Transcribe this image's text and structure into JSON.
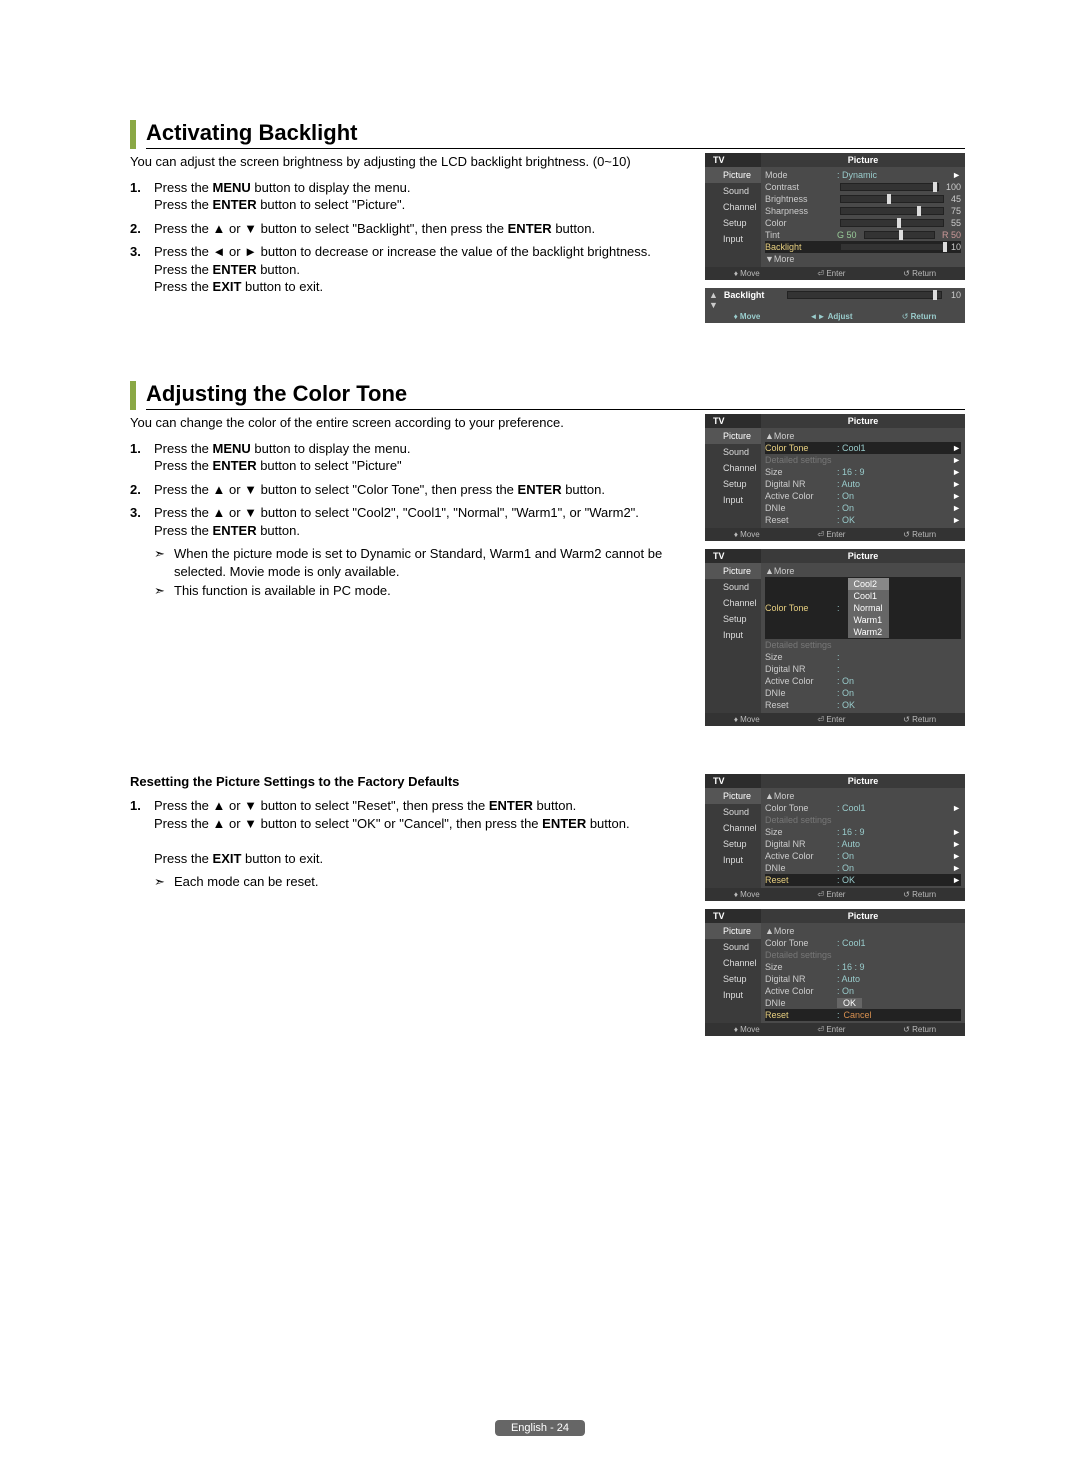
{
  "section1": {
    "title": "Activating Backlight",
    "intro": "You can adjust the screen brightness by adjusting the LCD backlight brightness. (0~10)",
    "steps": [
      {
        "num": "1.",
        "html": "Press the <b>MENU</b> button to display the menu.<br>Press the <b>ENTER</b> button to select \"Picture\"."
      },
      {
        "num": "2.",
        "html": "Press the ▲ or ▼ button to select \"Backlight\", then press the <b>ENTER</b> button."
      },
      {
        "num": "3.",
        "html": "Press the ◄ or ► button to decrease or increase the value of the backlight brightness.<br>Press the <b>ENTER</b> button.<br>Press the <b>EXIT</b> button to exit."
      }
    ]
  },
  "section2": {
    "title": "Adjusting the Color Tone",
    "intro": "You can change the color of the entire screen according to your preference.",
    "steps": [
      {
        "num": "1.",
        "html": "Press the <b>MENU</b> button to display the menu.<br>Press the <b>ENTER</b> button to select \"Picture\""
      },
      {
        "num": "2.",
        "html": "Press the ▲ or ▼ button to select \"Color Tone\", then press the <b>ENTER</b> button."
      },
      {
        "num": "3.",
        "html": "Press the ▲ or ▼ button to select \"Cool2\", \"Cool1\", \"Normal\", \"Warm1\", or \"Warm2\".<br>Press the <b>ENTER</b> button."
      }
    ],
    "notes": [
      "When the picture mode is set to Dynamic or Standard, Warm1 and Warm2 cannot be selected. Movie mode is only available.",
      "This function is available in PC mode."
    ]
  },
  "section3": {
    "subhead": "Resetting the Picture Settings to the Factory Defaults",
    "steps": [
      {
        "num": "1.",
        "html": "Press the ▲ or ▼ button to select \"Reset\", then press the <b>ENTER</b> button.<br>Press the ▲ or ▼ button to select \"OK\" or \"Cancel\", then press the <b>ENTER</b> button.<br><br>Press the <b>EXIT</b> button to exit."
      }
    ],
    "notes": [
      "Each mode can be reset."
    ]
  },
  "osd": {
    "tv": "TV",
    "picture": "Picture",
    "side": [
      "Picture",
      "Sound",
      "Channel",
      "Setup",
      "Input"
    ],
    "foot": {
      "move": "Move",
      "enter": "Enter",
      "return": "Return",
      "adjust": "Adjust"
    }
  },
  "osd1": {
    "rows": [
      {
        "label": "Mode",
        "val": ": Dynamic",
        "arrow": "►"
      },
      {
        "label": "Contrast",
        "slider": 95,
        "num": "100"
      },
      {
        "label": "Brightness",
        "slider": 45,
        "num": "45"
      },
      {
        "label": "Sharpness",
        "slider": 75,
        "num": "75"
      },
      {
        "label": "Color",
        "slider": 55,
        "num": "55"
      },
      {
        "label": "Tint",
        "tint": true,
        "g": "G 50",
        "r": "R 50"
      },
      {
        "label": "Backlight",
        "slider": 100,
        "num": "10",
        "sel": true
      },
      {
        "label": "▼More"
      }
    ]
  },
  "osd_mini": {
    "label": "Backlight",
    "num": "10"
  },
  "osd2": {
    "rows": [
      {
        "label": "▲More"
      },
      {
        "label": "Color Tone",
        "val": ": Cool1",
        "arrow": "►",
        "sel": true
      },
      {
        "label": "Detailed settings",
        "disabled": true,
        "arrow": "►"
      },
      {
        "label": "Size",
        "val": ": 16 : 9",
        "arrow": "►"
      },
      {
        "label": "Digital NR",
        "val": ": Auto",
        "arrow": "►"
      },
      {
        "label": "Active Color",
        "val": ": On",
        "arrow": "►"
      },
      {
        "label": "DNIe",
        "val": ": On",
        "arrow": "►"
      },
      {
        "label": "Reset",
        "val": ": OK",
        "arrow": "►"
      }
    ]
  },
  "osd3": {
    "rows": [
      {
        "label": "▲More"
      },
      {
        "label": "Color Tone",
        "val": ":",
        "sel": true,
        "dropdown": [
          "Cool2",
          "Cool1",
          "Normal",
          "Warm1",
          "Warm2"
        ],
        "hi": 0
      },
      {
        "label": "Detailed settings",
        "disabled": true
      },
      {
        "label": "Size",
        "val": ":"
      },
      {
        "label": "Digital NR",
        "val": ":"
      },
      {
        "label": "Active Color",
        "val": ": On"
      },
      {
        "label": "DNIe",
        "val": ": On"
      },
      {
        "label": "Reset",
        "val": ": OK"
      }
    ]
  },
  "osd4": {
    "rows": [
      {
        "label": "▲More"
      },
      {
        "label": "Color Tone",
        "val": ": Cool1",
        "arrow": "►"
      },
      {
        "label": "Detailed settings",
        "disabled": true
      },
      {
        "label": "Size",
        "val": ": 16 : 9",
        "arrow": "►"
      },
      {
        "label": "Digital NR",
        "val": ": Auto",
        "arrow": "►"
      },
      {
        "label": "Active Color",
        "val": ": On",
        "arrow": "►"
      },
      {
        "label": "DNIe",
        "val": ": On",
        "arrow": "►"
      },
      {
        "label": "Reset",
        "val": ": OK",
        "sel": true,
        "arrow": "►"
      }
    ]
  },
  "osd5": {
    "rows": [
      {
        "label": "▲More"
      },
      {
        "label": "Color Tone",
        "val": ": Cool1"
      },
      {
        "label": "Detailed settings",
        "disabled": true
      },
      {
        "label": "Size",
        "val": ": 16 : 9"
      },
      {
        "label": "Digital NR",
        "val": ": Auto"
      },
      {
        "label": "Active Color",
        "val": ": On"
      },
      {
        "label": "DNIe",
        "ok": true
      },
      {
        "label": "Reset",
        "val": ":",
        "sel": true,
        "cancel": "Cancel"
      }
    ]
  },
  "footer": "English - 24"
}
